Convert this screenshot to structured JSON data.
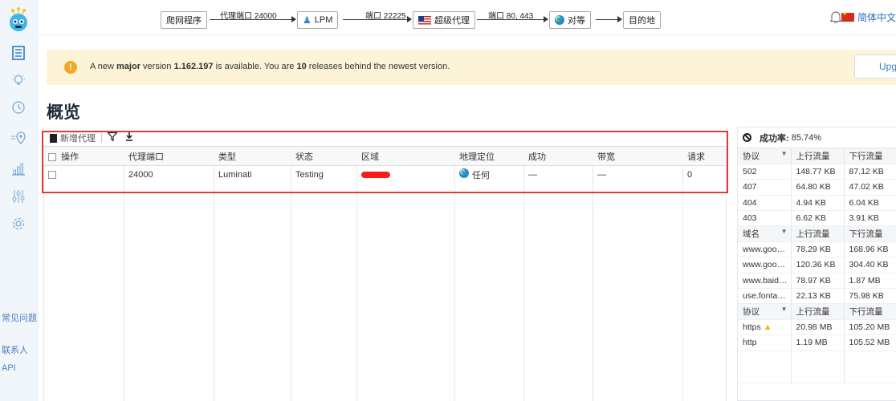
{
  "header": {
    "nodes": {
      "scraper": "爬网程序",
      "lpm": "LPM",
      "super_proxy": "超级代理",
      "peer": "对等",
      "destination": "目的地"
    },
    "arrows": {
      "a1": "代理端口 24000",
      "a2": "端口 22225",
      "a3": "端口 80, 443"
    },
    "language": "简体中文"
  },
  "sidebar": {
    "links": [
      "常见问题",
      "联系人",
      "API"
    ]
  },
  "banner": {
    "pre": "A new ",
    "major": "major",
    "mid": " version ",
    "version": "1.162.197",
    "mid2": " is available. You are ",
    "count": "10",
    "post": " releases behind the newest version.",
    "upgrade_label": "Upgrade"
  },
  "page_title": "概览",
  "toolbar": {
    "new_proxy": "新增代理"
  },
  "proxy_table": {
    "headers": [
      "操作",
      "代理端口",
      "类型",
      "状态",
      "区域",
      "地理定位",
      "成功",
      "带宽",
      "请求"
    ],
    "row": {
      "port": "24000",
      "type": "Luminati",
      "status": "Testing",
      "geo": "任何",
      "success": "—",
      "bandwidth": "—",
      "requests": "0"
    }
  },
  "stats": {
    "success_label": "成功率:",
    "success_value": "85.74%",
    "protocol_header": [
      "协议",
      "上行流量",
      "下行流量"
    ],
    "status_rows": [
      [
        "502",
        "148.77 KB",
        "87.12 KB"
      ],
      [
        "407",
        "64.80 KB",
        "47.02 KB"
      ],
      [
        "404",
        "4.94 KB",
        "6.04 KB"
      ],
      [
        "403",
        "6.62 KB",
        "3.91 KB"
      ]
    ],
    "domain_header": [
      "域名",
      "上行流量",
      "下行流量"
    ],
    "domain_rows": [
      [
        "www.goo…",
        "78.29 KB",
        "168.96 KB"
      ],
      [
        "www.goo…",
        "120.36 KB",
        "304.40 KB"
      ],
      [
        "www.baid…",
        "78.97 KB",
        "1.87 MB"
      ],
      [
        "use.fonta…",
        "22.13 KB",
        "75.98 KB"
      ]
    ],
    "proto_header": [
      "协议",
      "上行流量",
      "下行流量"
    ],
    "proto_rows": [
      [
        "https",
        "20.98 MB",
        "105.20 MB"
      ],
      [
        "http",
        "1.19 MB",
        "105.52 MB"
      ]
    ]
  }
}
